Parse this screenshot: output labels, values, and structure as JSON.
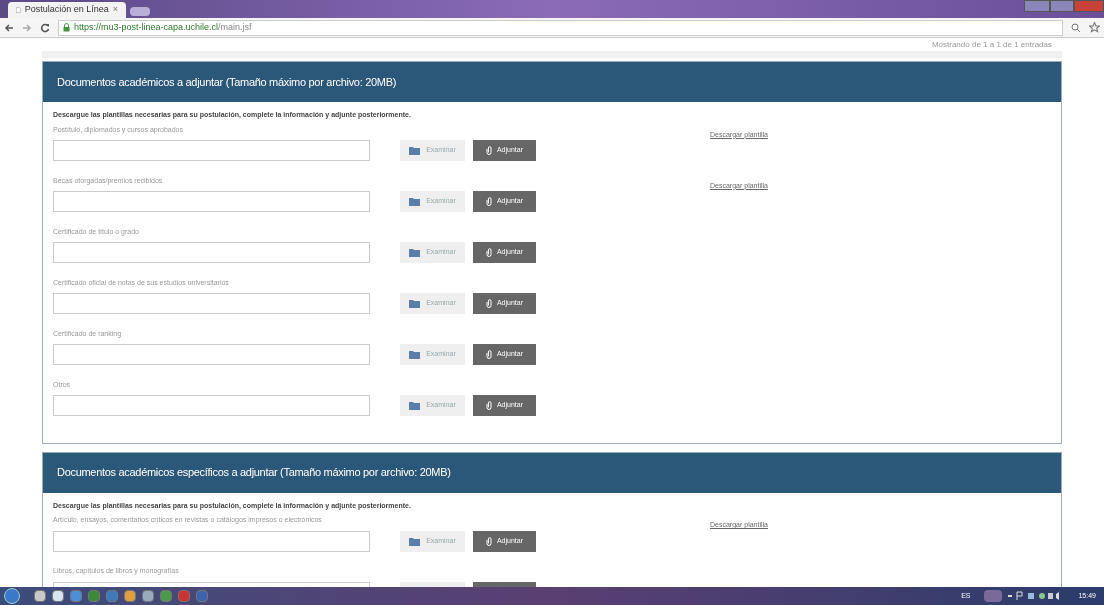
{
  "browser": {
    "tab_title": "Postulación en Línea",
    "tab_close": "×",
    "url_host": "https://mu3-post-linea-capa.uchile.cl",
    "url_path": "/main.jsf"
  },
  "table_info": "Mostrando de 1 a 1 de 1 entradas",
  "sections": [
    {
      "title": "Documentos académicos a adjuntar (Tamaño máximo por archivo: 20MB)",
      "instructions": "Descargue las plantillas necesarias para su postulación, complete la información y adjunte posteriormente.",
      "rows": [
        {
          "label": "Postítulo, diplomados y cursos aprobados",
          "browse": "Examinar",
          "attach": "Adjuntar",
          "download": "Descargar plantilla"
        },
        {
          "label": "Becas otorgadas/premios recibidos",
          "browse": "Examinar",
          "attach": "Adjuntar",
          "download": "Descargar plantilla"
        },
        {
          "label": "Certificado de título o grado",
          "browse": "Examinar",
          "attach": "Adjuntar"
        },
        {
          "label": "Certificado oficial de notas de sus estudios universitarios",
          "browse": "Examinar",
          "attach": "Adjuntar"
        },
        {
          "label": "Certificado de ranking",
          "browse": "Examinar",
          "attach": "Adjuntar"
        },
        {
          "label": "Otros",
          "browse": "Examinar",
          "attach": "Adjuntar"
        }
      ]
    },
    {
      "title": "Documentos académicos específicos a adjuntar (Tamaño máximo por archivo: 20MB)",
      "instructions": "Descargue las plantillas necesarias para su postulación, complete la información y adjunte posteriormente.",
      "rows": [
        {
          "label": "Artículo, ensayos, comentarios críticos en revistas o catálogos impresos o electrónicos",
          "browse": "Examinar",
          "attach": "Adjuntar",
          "download": "Descargar plantilla"
        },
        {
          "label": "Libros, capítulos de libros y monografías"
        }
      ]
    }
  ],
  "taskbar": {
    "language": "ES",
    "clock": "15:49"
  }
}
